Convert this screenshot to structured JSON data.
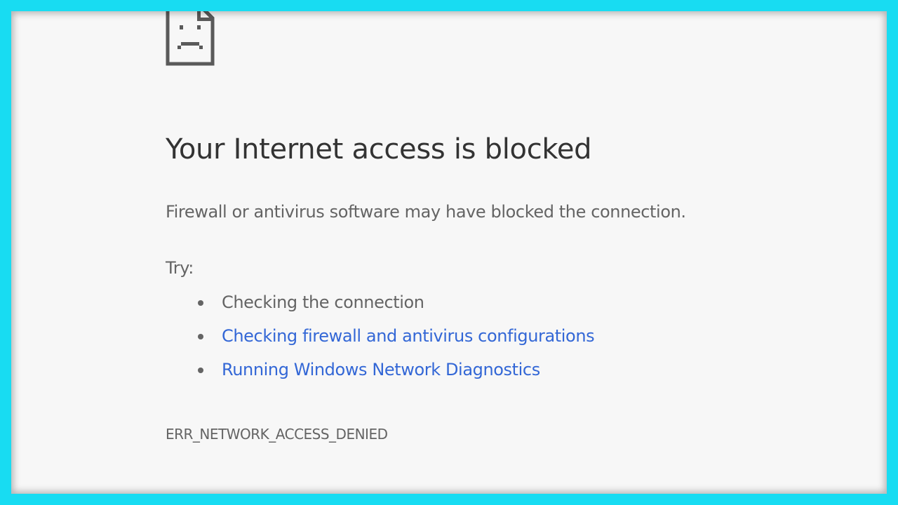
{
  "page": {
    "border_color": "#18dcf2",
    "background_color": "#f7f7f7",
    "link_color": "#3367d6",
    "text_color": "#646464",
    "heading_color": "#333333"
  },
  "icon": "sad-page-icon",
  "title": "Your Internet access is blocked",
  "subtitle": "Firewall or antivirus software may have blocked the connection.",
  "try_label": "Try:",
  "suggestions": [
    {
      "label": "Checking the connection",
      "is_link": false
    },
    {
      "label": "Checking firewall and antivirus configurations",
      "is_link": true
    },
    {
      "label": "Running Windows Network Diagnostics",
      "is_link": true
    }
  ],
  "error_code": "ERR_NETWORK_ACCESS_DENIED"
}
